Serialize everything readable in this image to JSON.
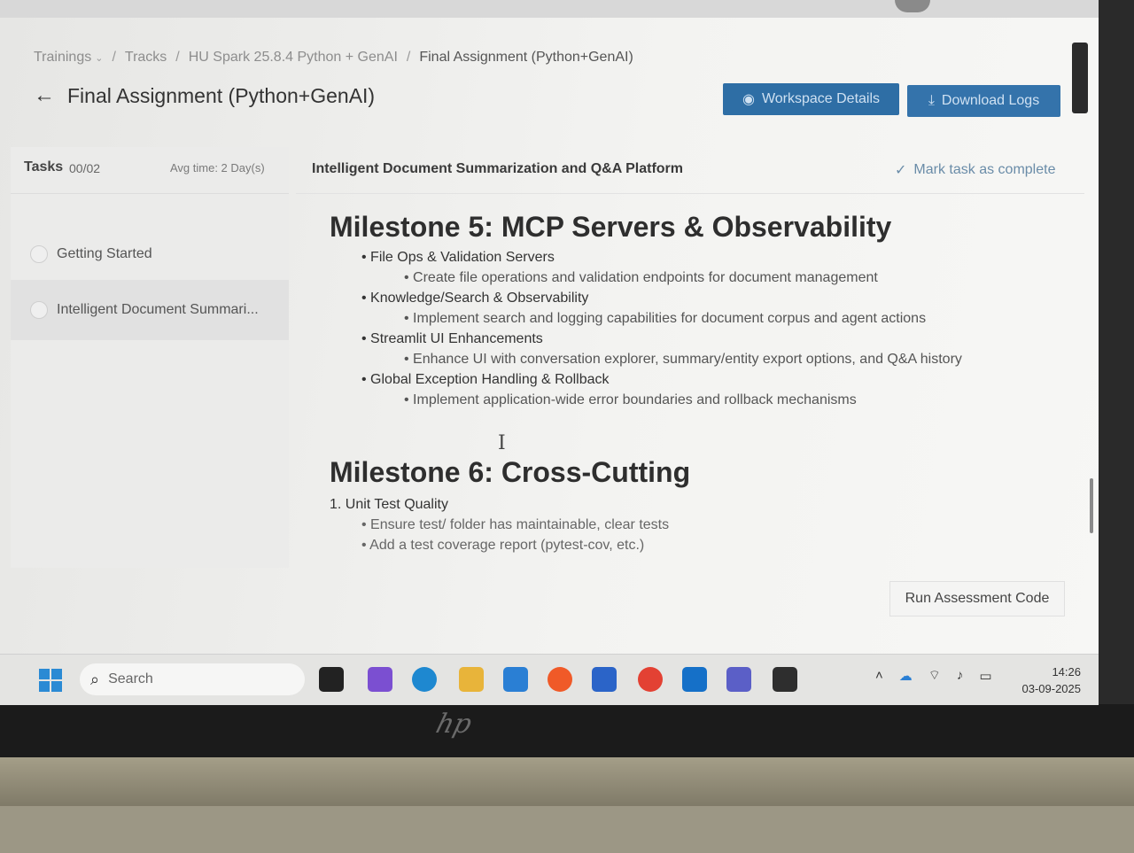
{
  "breadcrumb": {
    "items": [
      "Trainings",
      "Tracks",
      "HU Spark 25.8.4 Python + GenAI",
      "Final Assignment (Python+GenAI)"
    ]
  },
  "header": {
    "title": "Final Assignment (Python+GenAI)",
    "workspace_button": "Workspace Details",
    "download_button": "Download Logs"
  },
  "tasks_panel": {
    "label": "Tasks",
    "count": "00/02",
    "avg_time": "Avg time: 2 Day(s)",
    "items": [
      {
        "label": "Getting Started"
      },
      {
        "label": "Intelligent Document Summari..."
      }
    ]
  },
  "task": {
    "title": "Intelligent Document Summarization and Q&A Platform",
    "mark_complete": "Mark task as complete"
  },
  "content": {
    "milestone5": {
      "title": "Milestone 5: MCP Servers & Observability",
      "sections": [
        {
          "heading": "File Ops & Validation Servers",
          "detail": "Create file operations and validation endpoints for document management"
        },
        {
          "heading": "Knowledge/Search & Observability",
          "detail": "Implement search and logging capabilities for document corpus and agent actions"
        },
        {
          "heading": "Streamlit UI Enhancements",
          "detail": "Enhance UI with conversation explorer, summary/entity export options, and Q&A history"
        },
        {
          "heading": "Global Exception Handling & Rollback",
          "detail": "Implement application-wide error boundaries and rollback mechanisms"
        }
      ]
    },
    "milestone6": {
      "title": "Milestone 6: Cross-Cutting",
      "item1": "1. Unit Test Quality",
      "item1_bullets": [
        "Ensure test/ folder has maintainable, clear tests",
        "Add a test coverage report (pytest-cov, etc.)"
      ]
    }
  },
  "run_button": "Run Assessment Code",
  "taskbar": {
    "search_placeholder": "Search",
    "time": "14:26",
    "date": "03-09-2025"
  }
}
